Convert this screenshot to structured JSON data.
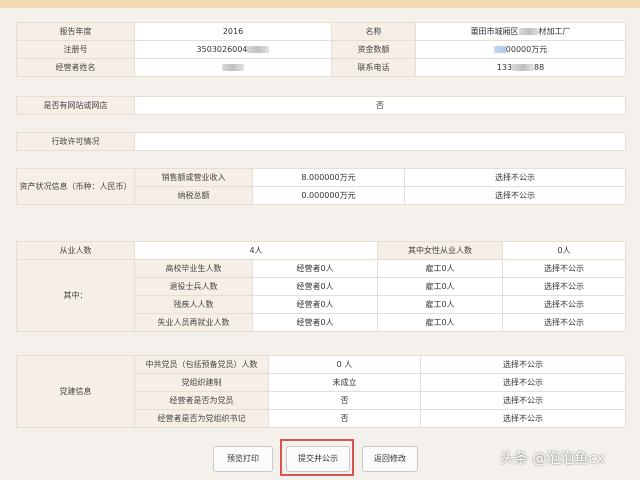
{
  "basic": {
    "year_label": "报告年度",
    "year_value": "2016",
    "name_label": "名称",
    "name_prefix": "莆田市城厢区",
    "name_suffix": "材加工厂",
    "reg_label": "注册号",
    "reg_prefix": "3503026004",
    "capital_label": "资金数额",
    "capital_suffix": "00000万元",
    "operator_label": "经营者姓名",
    "phone_label": "联系电话",
    "phone_prefix": "133",
    "phone_suffix": "88"
  },
  "website": {
    "label": "是否有网站或网店",
    "value": "否"
  },
  "license": {
    "label": "行政许可情况"
  },
  "assets": {
    "label": "资产状况信息（币种：人民币）",
    "rows": [
      {
        "name": "销售额或营业收入",
        "value": "8.000000万元",
        "status": "选择不公示"
      },
      {
        "name": "纳税总额",
        "value": "0.000000万元",
        "status": "选择不公示"
      }
    ]
  },
  "employees": {
    "count_label": "从业人数",
    "count_value": "4人",
    "female_label": "其中女性从业人数",
    "female_value": "0人",
    "sub_label": "其中：",
    "rows": [
      {
        "name": "高校毕业生人数",
        "op": "经营者0人",
        "emp": "雇工0人",
        "status": "选择不公示"
      },
      {
        "name": "退役士兵人数",
        "op": "经营者0人",
        "emp": "雇工0人",
        "status": "选择不公示"
      },
      {
        "name": "残疾人人数",
        "op": "经营者0人",
        "emp": "雇工0人",
        "status": "选择不公示"
      },
      {
        "name": "失业人员再就业人数",
        "op": "经营者0人",
        "emp": "雇工0人",
        "status": "选择不公示"
      }
    ]
  },
  "party": {
    "label": "党建信息",
    "rows": [
      {
        "name": "中共党员（包括预备党员）人数",
        "value": "0 人",
        "status": "选择不公示"
      },
      {
        "name": "党组织建制",
        "value": "未成立",
        "status": "选择不公示"
      },
      {
        "name": "经营者是否为党员",
        "value": "否",
        "status": "选择不公示"
      },
      {
        "name": "经营者是否为党组织书记",
        "value": "否",
        "status": "选择不公示"
      }
    ]
  },
  "buttons": {
    "print": "预览打印",
    "submit": "提交并公示",
    "back": "返回修改"
  },
  "watermark": "头条 @泡泡鱼cx"
}
